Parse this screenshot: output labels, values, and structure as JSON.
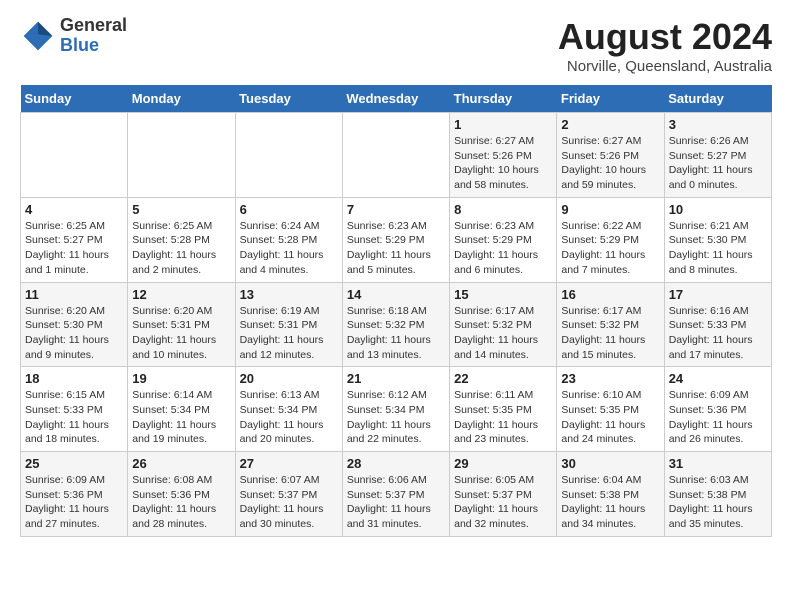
{
  "header": {
    "logo": {
      "general": "General",
      "blue": "Blue"
    },
    "title": "August 2024",
    "subtitle": "Norville, Queensland, Australia"
  },
  "days_of_week": [
    "Sunday",
    "Monday",
    "Tuesday",
    "Wednesday",
    "Thursday",
    "Friday",
    "Saturday"
  ],
  "weeks": [
    [
      {
        "day": "",
        "info": ""
      },
      {
        "day": "",
        "info": ""
      },
      {
        "day": "",
        "info": ""
      },
      {
        "day": "",
        "info": ""
      },
      {
        "day": "1",
        "sunrise": "6:27 AM",
        "sunset": "5:26 PM",
        "daylight": "10 hours and 58 minutes."
      },
      {
        "day": "2",
        "sunrise": "6:27 AM",
        "sunset": "5:26 PM",
        "daylight": "10 hours and 59 minutes."
      },
      {
        "day": "3",
        "sunrise": "6:26 AM",
        "sunset": "5:27 PM",
        "daylight": "11 hours and 0 minutes."
      }
    ],
    [
      {
        "day": "4",
        "sunrise": "6:25 AM",
        "sunset": "5:27 PM",
        "daylight": "11 hours and 1 minute."
      },
      {
        "day": "5",
        "sunrise": "6:25 AM",
        "sunset": "5:28 PM",
        "daylight": "11 hours and 2 minutes."
      },
      {
        "day": "6",
        "sunrise": "6:24 AM",
        "sunset": "5:28 PM",
        "daylight": "11 hours and 4 minutes."
      },
      {
        "day": "7",
        "sunrise": "6:23 AM",
        "sunset": "5:29 PM",
        "daylight": "11 hours and 5 minutes."
      },
      {
        "day": "8",
        "sunrise": "6:23 AM",
        "sunset": "5:29 PM",
        "daylight": "11 hours and 6 minutes."
      },
      {
        "day": "9",
        "sunrise": "6:22 AM",
        "sunset": "5:29 PM",
        "daylight": "11 hours and 7 minutes."
      },
      {
        "day": "10",
        "sunrise": "6:21 AM",
        "sunset": "5:30 PM",
        "daylight": "11 hours and 8 minutes."
      }
    ],
    [
      {
        "day": "11",
        "sunrise": "6:20 AM",
        "sunset": "5:30 PM",
        "daylight": "11 hours and 9 minutes."
      },
      {
        "day": "12",
        "sunrise": "6:20 AM",
        "sunset": "5:31 PM",
        "daylight": "11 hours and 10 minutes."
      },
      {
        "day": "13",
        "sunrise": "6:19 AM",
        "sunset": "5:31 PM",
        "daylight": "11 hours and 12 minutes."
      },
      {
        "day": "14",
        "sunrise": "6:18 AM",
        "sunset": "5:32 PM",
        "daylight": "11 hours and 13 minutes."
      },
      {
        "day": "15",
        "sunrise": "6:17 AM",
        "sunset": "5:32 PM",
        "daylight": "11 hours and 14 minutes."
      },
      {
        "day": "16",
        "sunrise": "6:17 AM",
        "sunset": "5:32 PM",
        "daylight": "11 hours and 15 minutes."
      },
      {
        "day": "17",
        "sunrise": "6:16 AM",
        "sunset": "5:33 PM",
        "daylight": "11 hours and 17 minutes."
      }
    ],
    [
      {
        "day": "18",
        "sunrise": "6:15 AM",
        "sunset": "5:33 PM",
        "daylight": "11 hours and 18 minutes."
      },
      {
        "day": "19",
        "sunrise": "6:14 AM",
        "sunset": "5:34 PM",
        "daylight": "11 hours and 19 minutes."
      },
      {
        "day": "20",
        "sunrise": "6:13 AM",
        "sunset": "5:34 PM",
        "daylight": "11 hours and 20 minutes."
      },
      {
        "day": "21",
        "sunrise": "6:12 AM",
        "sunset": "5:34 PM",
        "daylight": "11 hours and 22 minutes."
      },
      {
        "day": "22",
        "sunrise": "6:11 AM",
        "sunset": "5:35 PM",
        "daylight": "11 hours and 23 minutes."
      },
      {
        "day": "23",
        "sunrise": "6:10 AM",
        "sunset": "5:35 PM",
        "daylight": "11 hours and 24 minutes."
      },
      {
        "day": "24",
        "sunrise": "6:09 AM",
        "sunset": "5:36 PM",
        "daylight": "11 hours and 26 minutes."
      }
    ],
    [
      {
        "day": "25",
        "sunrise": "6:09 AM",
        "sunset": "5:36 PM",
        "daylight": "11 hours and 27 minutes."
      },
      {
        "day": "26",
        "sunrise": "6:08 AM",
        "sunset": "5:36 PM",
        "daylight": "11 hours and 28 minutes."
      },
      {
        "day": "27",
        "sunrise": "6:07 AM",
        "sunset": "5:37 PM",
        "daylight": "11 hours and 30 minutes."
      },
      {
        "day": "28",
        "sunrise": "6:06 AM",
        "sunset": "5:37 PM",
        "daylight": "11 hours and 31 minutes."
      },
      {
        "day": "29",
        "sunrise": "6:05 AM",
        "sunset": "5:37 PM",
        "daylight": "11 hours and 32 minutes."
      },
      {
        "day": "30",
        "sunrise": "6:04 AM",
        "sunset": "5:38 PM",
        "daylight": "11 hours and 34 minutes."
      },
      {
        "day": "31",
        "sunrise": "6:03 AM",
        "sunset": "5:38 PM",
        "daylight": "11 hours and 35 minutes."
      }
    ]
  ]
}
